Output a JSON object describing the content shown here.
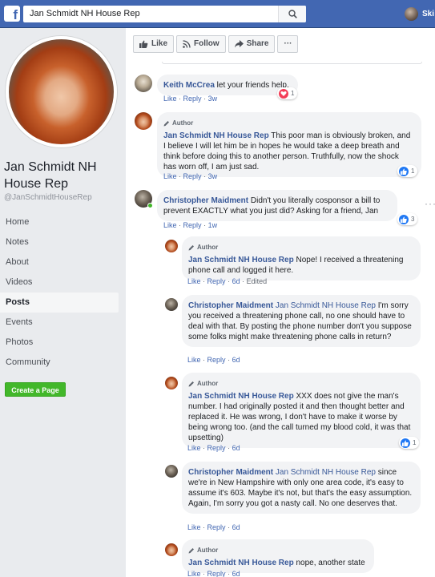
{
  "topbar": {
    "search_value": "Jan Schmidt NH House Rep",
    "user_name": "Ski",
    "logo": "f",
    "colors": {
      "bar": "#4267b2"
    }
  },
  "page": {
    "name": "Jan Schmidt NH House Rep",
    "handle": "@JanSchmidtHouseRep",
    "nav": [
      "Home",
      "Notes",
      "About",
      "Videos",
      "Posts",
      "Events",
      "Photos",
      "Community"
    ],
    "active_nav": "Posts",
    "create_page_label": "Create a Page"
  },
  "actions": {
    "like": "Like",
    "follow": "Follow",
    "share": "Share",
    "more": "···"
  },
  "labels": {
    "author": "Author",
    "like": "Like",
    "reply": "Reply",
    "sep": "·"
  },
  "comments": [
    {
      "author": "Keith McCrea",
      "text": " let your friends help.",
      "time": "3w",
      "reaction": {
        "type": "love",
        "count": "1"
      }
    },
    {
      "author": "Jan Schmidt NH House Rep",
      "is_author": true,
      "text": " This poor man is obviously broken, and I believe I will let him be in hopes he would take a deep breath and think before doing this to another person. Truthfully, now the shock has worn off, I am just sad.",
      "time": "3w",
      "reaction": {
        "type": "like",
        "count": "1"
      }
    },
    {
      "author": "Christopher Maidment",
      "text": " Didn't you literally cosponsor a bill to prevent EXACTLY what you just did? Asking for a friend, Jan",
      "time": "1w",
      "reaction": {
        "type": "like",
        "count": "3"
      }
    }
  ],
  "replies": [
    {
      "author": "Jan Schmidt NH House Rep",
      "is_author": true,
      "text": " Nope! I received a threatening phone call and logged it here.",
      "time": "6d",
      "edited": "Edited"
    },
    {
      "author": "Christopher Maidment",
      "tag": "Jan Schmidt NH House Rep",
      "text": " I'm sorry you received a threatening phone call, no one should have to deal with that. By posting the phone number don't you suppose some folks might make threatening phone calls in return?",
      "time": "6d"
    },
    {
      "author": "Jan Schmidt NH House Rep",
      "is_author": true,
      "text": " XXX does not give the man's number. I had originally posted it and then thought better and replaced it. He was wrong, I don't have to make it worse by being wrong too. (and the call turned my blood cold, it was that upsetting)",
      "time": "6d",
      "reaction": {
        "type": "like",
        "count": "1"
      }
    },
    {
      "author": "Christopher Maidment",
      "tag": "Jan Schmidt NH House Rep",
      "text": " since we're in New Hampshire with only one area code, it's easy to assume it's 603. Maybe it's not, but that's the easy assumption. Again, I'm sorry you got a nasty call. No one deserves that.",
      "time": "6d"
    },
    {
      "author": "Jan Schmidt NH House Rep",
      "is_author": true,
      "text": " nope, another state",
      "time": "6d"
    }
  ]
}
